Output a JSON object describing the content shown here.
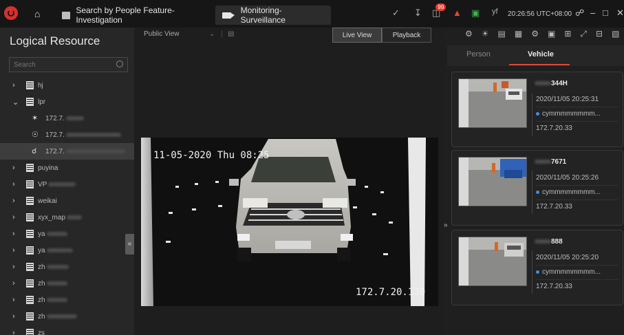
{
  "topbar": {
    "tabs": [
      {
        "label": "Search by People Feature-Investigation",
        "icon": "list-icon"
      },
      {
        "label": "Monitoring-Surveillance",
        "icon": "camera-icon"
      }
    ],
    "alarm_badge": "99",
    "user": "yf",
    "clock": "20:26:56 UTC+08:00"
  },
  "sidebar": {
    "title": "Logical Resource",
    "search_placeholder": "Search",
    "nodes": [
      {
        "label": "hj",
        "expanded": false
      },
      {
        "label": "lpr",
        "expanded": true
      },
      {
        "label": "172.7.",
        "device": true,
        "icon": "camera-icon"
      },
      {
        "label": "172.7.",
        "device": true,
        "icon": "target-camera-icon"
      },
      {
        "label": "172.7.",
        "device": true,
        "icon": "anpr-camera-icon",
        "selected": true
      },
      {
        "label": "puyina",
        "expanded": false
      },
      {
        "label": "VP",
        "expanded": false
      },
      {
        "label": "weikai",
        "expanded": false
      },
      {
        "label": "xyx_map",
        "expanded": false
      },
      {
        "label": "ya",
        "expanded": false
      },
      {
        "label": "ya",
        "expanded": false
      },
      {
        "label": "zh",
        "expanded": false
      },
      {
        "label": "zh",
        "expanded": false
      },
      {
        "label": "zh",
        "expanded": false
      },
      {
        "label": "zh",
        "expanded": false
      },
      {
        "label": "zs",
        "expanded": false
      }
    ]
  },
  "center": {
    "view_selector": "Public View",
    "modes": {
      "live": "Live View",
      "playback": "Playback"
    },
    "video": {
      "osd_date": "11-05-2020 Thu 08:25",
      "osd_ip": "172.7.20.130"
    }
  },
  "right": {
    "tabs": {
      "person": "Person",
      "vehicle": "Vehicle"
    },
    "cards": [
      {
        "plate": "344H",
        "time": "2020/11/05 20:25:31",
        "user": "cymmmmmmmm...",
        "ip": "172.7.20.33"
      },
      {
        "plate": "7671",
        "time": "2020/11/05 20:25:26",
        "user": "cymmmmmmmm...",
        "ip": "172.7.20.33"
      },
      {
        "plate": "888",
        "time": "2020/11/05 20:25:20",
        "user": "cymmmmmmmm...",
        "ip": "172.7.20.33"
      }
    ]
  }
}
